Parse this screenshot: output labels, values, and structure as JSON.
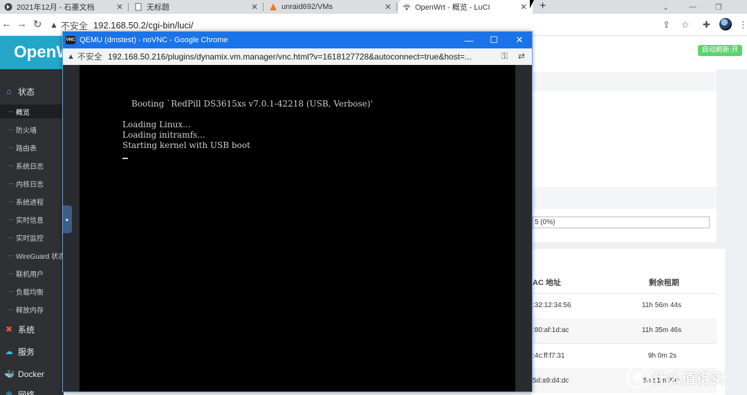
{
  "browser": {
    "tabs": [
      {
        "title": "2021年12月 - 石墨文档",
        "icon": "shimo-icon"
      },
      {
        "title": "无标题",
        "icon": "doc-icon"
      },
      {
        "title": "unraid692/VMs",
        "icon": "unraid-icon"
      },
      {
        "title": "OpenWrt - 概览 - LuCI",
        "icon": "openwrt-icon",
        "active": true
      }
    ],
    "new_tab": "+",
    "address": {
      "security_label": "不安全",
      "url": "192.168.50.2/cgi-bin/luci/"
    }
  },
  "openwrt": {
    "logo": "OpenWrt",
    "auto_refresh": "自动刷新:开",
    "menu": {
      "status": "状态",
      "status_items": [
        "概览",
        "防火墙",
        "路由表",
        "系统日志",
        "内核日志",
        "系统进程",
        "实时信息",
        "实时监控",
        "WireGuard 状态",
        "联机用户",
        "负载均衡",
        "释放内存"
      ],
      "system": "系统",
      "services": "服务",
      "docker": "Docker",
      "network": "网络"
    },
    "progress_text": "5 (0%)",
    "lease_table": {
      "headers": [
        "AC 地址",
        "剩余租期"
      ],
      "rows": [
        {
          "mac": ":32:12:34:56",
          "lease": "11h 56m 44s"
        },
        {
          "mac": ":80:af:1d:ac",
          "lease": "11h 35m 46s"
        },
        {
          "mac": ":4c:ff:f7:31",
          "lease": "9h 0m 2s"
        },
        {
          "mac": "5d:a9:d4:dc",
          "lease": "5h 51m 30s"
        }
      ]
    }
  },
  "popup": {
    "title": "QEMU (dmstest) - noVNC - Google Chrome",
    "vnc_badge": "VNC",
    "address": {
      "security_label": "不安全",
      "url": "192.168.50.216/plugins/dynamix.vm.manager/vnc.html?v=1618127728&autoconnect=true&host=..."
    },
    "console_lines": [
      "Booting `RedPill DS3615xs v7.0.1-42218 (USB, Verbose)'",
      "Loading Linux...",
      "Loading initramfs...",
      "Starting kernel with USB boot"
    ]
  },
  "watermark": {
    "circle": "值",
    "text": "什么值得买"
  },
  "colors": {
    "accent": "#23a6c8",
    "sidebar": "#2f3033",
    "popup_titlebar": "#1a73e8",
    "refresh_badge": "#5cd36b"
  }
}
